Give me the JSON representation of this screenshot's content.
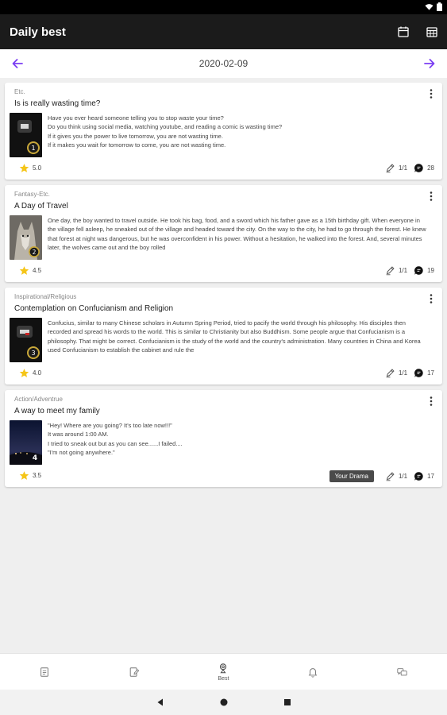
{
  "app": {
    "title": "Daily best"
  },
  "date_nav": {
    "date": "2020-02-09"
  },
  "stories": [
    {
      "genre": "Etc.",
      "title": "Is is really wasting time?",
      "summary": "Have you ever heard someone telling you to stop waste your time?\nDo you think using social media, watching youtube, and reading a comic is wasting time?\nIf it gives you the power to live tomorrow, you are not wasting time.\nIf it makes you wait for tomorrow to come, you are not wasting time.",
      "thumb_badge": "1",
      "rating": "5.0",
      "chapters": "1/1",
      "comments": "28",
      "tag": ""
    },
    {
      "genre": "Fantasy-Etc.",
      "title": "A Day of Travel",
      "summary": "One day, the boy wanted to travel outside. He took his bag, food, and a sword which his father gave as a 15th birthday gift. When everyone in the village fell asleep, he sneaked out of the village and headed toward the city. On the way to the city, he had to go through the forest. He knew that forest at night was dangerous, but he was overconfident in his power. Without a hesitation, he walked into the forest. And, several minutes later, the wolves came out and the boy rolled",
      "thumb_badge": "2",
      "rating": "4.5",
      "chapters": "1/1",
      "comments": "19",
      "tag": ""
    },
    {
      "genre": "Inspirational/Religious",
      "title": "Contemplation on Confucianism and Religion",
      "summary": "Confucius, similar to many Chinese scholars in Autumn Spring Period, tried to pacify the world through his philosophy. His disciples then recorded and spread his words to the world. This is similar to Christianity but also Buddhism. Some people argue that Confucianism is a philosophy. That might be correct. Confucianism is the study of the world and the country's administration. Many countries in China and Korea used Confucianism to establish the cabinet and rule the",
      "thumb_badge": "3",
      "rating": "4.0",
      "chapters": "1/1",
      "comments": "17",
      "tag": ""
    },
    {
      "genre": "Action/Adventrue",
      "title": "A way to meet my family",
      "summary": "\"Hey! Where are you going? It's too late now!!!\"\nIt was around 1:00 AM.\nI tried to sneak out but as you can see......I failed....\n\"I'm not going anywhere.\"",
      "thumb_badge": "4",
      "rating": "3.5",
      "chapters": "1/1",
      "comments": "17",
      "tag": "Your Drama"
    }
  ],
  "bottom_nav": [
    {
      "label": "",
      "icon": "list-icon"
    },
    {
      "label": "",
      "icon": "edit-icon"
    },
    {
      "label": "Best",
      "icon": "trophy-icon"
    },
    {
      "label": "",
      "icon": "bell-icon"
    },
    {
      "label": "",
      "icon": "chat-icon"
    }
  ],
  "colors": {
    "accent": "#7b3ff2",
    "star": "#f5c518",
    "appbar": "#1b1b1b"
  }
}
